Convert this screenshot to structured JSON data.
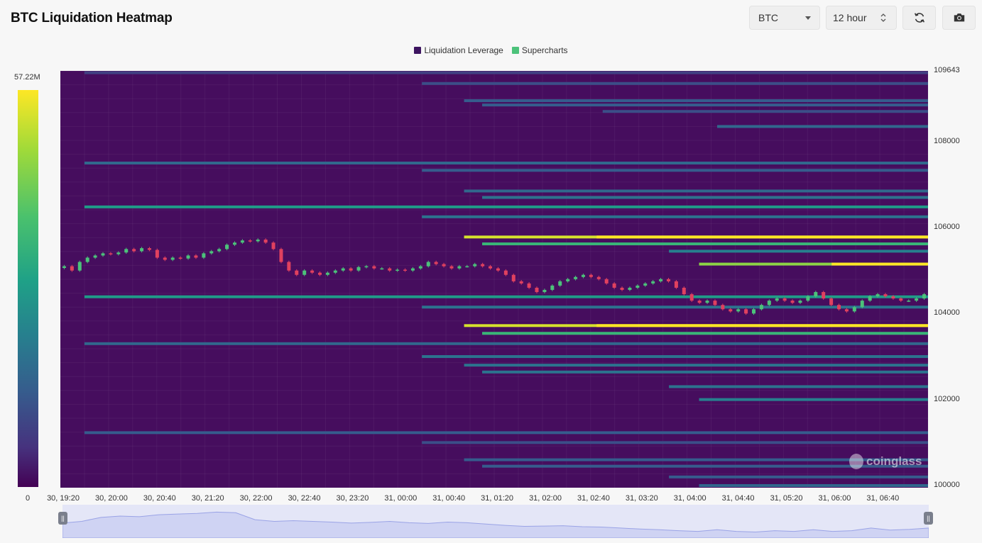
{
  "page": {
    "title": "BTC Liquidation Heatmap",
    "coin_select": {
      "value": "BTC"
    },
    "range_select": {
      "value": "12 hour"
    },
    "buttons": {
      "refresh": "refresh-icon",
      "screenshot": "camera-icon"
    }
  },
  "legend": [
    {
      "label": "Liquidation Leverage",
      "color": "#3d1460"
    },
    {
      "label": "Supercharts",
      "color": "#4cc27a"
    }
  ],
  "colorscale": {
    "max_label": "57.22M",
    "min_label": "0"
  },
  "watermark": "coinglass",
  "chart_data": {
    "type": "heatmap",
    "y_ticks": [
      "109643",
      "108000",
      "106000",
      "104000",
      "102000",
      "100000"
    ],
    "x_ticks": [
      "30, 19:20",
      "30, 20:00",
      "30, 20:40",
      "30, 21:20",
      "30, 22:00",
      "30, 22:40",
      "30, 23:20",
      "31, 00:00",
      "31, 00:40",
      "31, 01:20",
      "31, 02:00",
      "31, 02:40",
      "31, 03:20",
      "31, 04:00",
      "31, 04:40",
      "31, 05:20",
      "31, 06:00",
      "31, 06:40"
    ],
    "ylim": [
      99950,
      109643
    ],
    "xlim_minutes": [
      0,
      720
    ],
    "levels": [
      {
        "price": 109600,
        "from_min": 20,
        "intensity": 0.25
      },
      {
        "price": 109350,
        "from_min": 300,
        "intensity": 0.3
      },
      {
        "price": 108950,
        "from_min": 335,
        "intensity": 0.35
      },
      {
        "price": 108850,
        "from_min": 350,
        "intensity": 0.35
      },
      {
        "price": 108700,
        "from_min": 450,
        "intensity": 0.3
      },
      {
        "price": 108350,
        "from_min": 545,
        "intensity": 0.4
      },
      {
        "price": 107500,
        "from_min": 20,
        "intensity": 0.4
      },
      {
        "price": 107330,
        "from_min": 300,
        "intensity": 0.35
      },
      {
        "price": 106850,
        "from_min": 335,
        "intensity": 0.4
      },
      {
        "price": 106700,
        "from_min": 350,
        "intensity": 0.45
      },
      {
        "price": 106480,
        "from_min": 20,
        "intensity": 0.6
      },
      {
        "price": 106250,
        "from_min": 300,
        "intensity": 0.45
      },
      {
        "price": 105780,
        "from_min": 335,
        "intensity": 0.95
      },
      {
        "price": 105620,
        "from_min": 350,
        "intensity": 0.7
      },
      {
        "price": 105450,
        "from_min": 505,
        "intensity": 0.5
      },
      {
        "price": 105150,
        "from_min": 530,
        "intensity": 0.85
      },
      {
        "price": 104390,
        "from_min": 20,
        "intensity": 0.6
      },
      {
        "price": 104150,
        "from_min": 300,
        "intensity": 0.45
      },
      {
        "price": 103720,
        "from_min": 335,
        "intensity": 0.95
      },
      {
        "price": 103540,
        "from_min": 350,
        "intensity": 0.7
      },
      {
        "price": 103300,
        "from_min": 20,
        "intensity": 0.4
      },
      {
        "price": 103000,
        "from_min": 300,
        "intensity": 0.45
      },
      {
        "price": 102800,
        "from_min": 335,
        "intensity": 0.45
      },
      {
        "price": 102640,
        "from_min": 350,
        "intensity": 0.45
      },
      {
        "price": 102300,
        "from_min": 505,
        "intensity": 0.45
      },
      {
        "price": 102000,
        "from_min": 530,
        "intensity": 0.5
      },
      {
        "price": 101230,
        "from_min": 20,
        "intensity": 0.35
      },
      {
        "price": 101000,
        "from_min": 300,
        "intensity": 0.3
      },
      {
        "price": 100600,
        "from_min": 335,
        "intensity": 0.35
      },
      {
        "price": 100450,
        "from_min": 350,
        "intensity": 0.35
      },
      {
        "price": 100200,
        "from_min": 505,
        "intensity": 0.35
      },
      {
        "price": 100000,
        "from_min": 530,
        "intensity": 0.4
      }
    ],
    "candles_close": [
      105100,
      105000,
      105200,
      105300,
      105350,
      105400,
      105380,
      105420,
      105500,
      105450,
      105520,
      105480,
      105300,
      105250,
      105300,
      105280,
      105350,
      105300,
      105400,
      105450,
      105500,
      105600,
      105650,
      105700,
      105680,
      105720,
      105650,
      105500,
      105200,
      105000,
      104900,
      105000,
      104950,
      104900,
      104950,
      105000,
      105050,
      105000,
      105080,
      105100,
      105050,
      105050,
      105000,
      105020,
      105000,
      105050,
      105100,
      105200,
      105150,
      105100,
      105050,
      105100,
      105100,
      105150,
      105100,
      105050,
      105000,
      104900,
      104750,
      104700,
      104600,
      104500,
      104550,
      104650,
      104750,
      104800,
      104850,
      104900,
      104850,
      104800,
      104700,
      104600,
      104550,
      104600,
      104650,
      104700,
      104750,
      104800,
      104750,
      104600,
      104450,
      104300,
      104250,
      104300,
      104200,
      104100,
      104050,
      104100,
      104000,
      104100,
      104200,
      104300,
      104350,
      104300,
      104250,
      104300,
      104400,
      104500,
      104350,
      104200,
      104100,
      104050,
      104150,
      104300,
      104400,
      104450,
      104400,
      104350,
      104300,
      104300,
      104350,
      104450
    ],
    "navigator": [
      0.45,
      0.5,
      0.62,
      0.66,
      0.64,
      0.7,
      0.72,
      0.74,
      0.78,
      0.76,
      0.55,
      0.5,
      0.52,
      0.5,
      0.48,
      0.45,
      0.47,
      0.5,
      0.46,
      0.44,
      0.48,
      0.46,
      0.42,
      0.38,
      0.35,
      0.36,
      0.37,
      0.34,
      0.33,
      0.3,
      0.27,
      0.25,
      0.22,
      0.2,
      0.25,
      0.2,
      0.18,
      0.22,
      0.2,
      0.25,
      0.2,
      0.22,
      0.3,
      0.24,
      0.26,
      0.3
    ]
  }
}
